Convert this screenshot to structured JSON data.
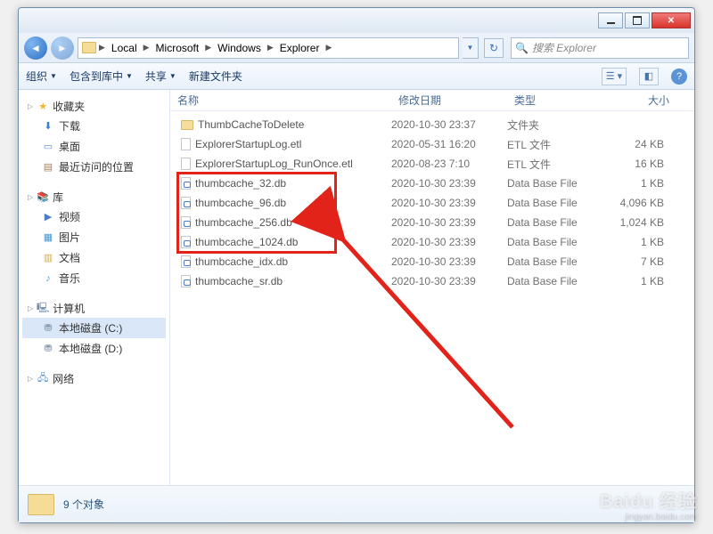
{
  "titlebar": {
    "min": "minimize",
    "max": "maximize",
    "close": "close"
  },
  "breadcrumb": [
    "Local",
    "Microsoft",
    "Windows",
    "Explorer"
  ],
  "search": {
    "placeholder": "搜索 Explorer"
  },
  "toolbar": {
    "organize": "组织",
    "include": "包含到库中",
    "share": "共享",
    "newfolder": "新建文件夹"
  },
  "sidebar": {
    "favorites": {
      "head": "收藏夹",
      "items": [
        "下载",
        "桌面",
        "最近访问的位置"
      ]
    },
    "libraries": {
      "head": "库",
      "items": [
        "视频",
        "图片",
        "文档",
        "音乐"
      ]
    },
    "computer": {
      "head": "计算机",
      "items": [
        "本地磁盘 (C:)",
        "本地磁盘 (D:)"
      ]
    },
    "network": {
      "head": "网络"
    }
  },
  "columns": {
    "name": "名称",
    "date": "修改日期",
    "type": "类型",
    "size": "大小"
  },
  "files": [
    {
      "name": "ThumbCacheToDelete",
      "date": "2020-10-30 23:37",
      "type": "文件夹",
      "size": "",
      "icon": "folder"
    },
    {
      "name": "ExplorerStartupLog.etl",
      "date": "2020-05-31 16:20",
      "type": "ETL 文件",
      "size": "24 KB",
      "icon": "etl"
    },
    {
      "name": "ExplorerStartupLog_RunOnce.etl",
      "date": "2020-08-23 7:10",
      "type": "ETL 文件",
      "size": "16 KB",
      "icon": "etl"
    },
    {
      "name": "thumbcache_32.db",
      "date": "2020-10-30 23:39",
      "type": "Data Base File",
      "size": "1 KB",
      "icon": "db"
    },
    {
      "name": "thumbcache_96.db",
      "date": "2020-10-30 23:39",
      "type": "Data Base File",
      "size": "4,096 KB",
      "icon": "db"
    },
    {
      "name": "thumbcache_256.db",
      "date": "2020-10-30 23:39",
      "type": "Data Base File",
      "size": "1,024 KB",
      "icon": "db"
    },
    {
      "name": "thumbcache_1024.db",
      "date": "2020-10-30 23:39",
      "type": "Data Base File",
      "size": "1 KB",
      "icon": "db"
    },
    {
      "name": "thumbcache_idx.db",
      "date": "2020-10-30 23:39",
      "type": "Data Base File",
      "size": "7 KB",
      "icon": "db"
    },
    {
      "name": "thumbcache_sr.db",
      "date": "2020-10-30 23:39",
      "type": "Data Base File",
      "size": "1 KB",
      "icon": "db"
    }
  ],
  "status": {
    "count": "9 个对象"
  },
  "watermark": {
    "brand": "Baidu 经验",
    "url": "jingyan.baidu.com"
  },
  "annotation": {
    "highlighted_rows": [
      3,
      4,
      5,
      6
    ]
  }
}
